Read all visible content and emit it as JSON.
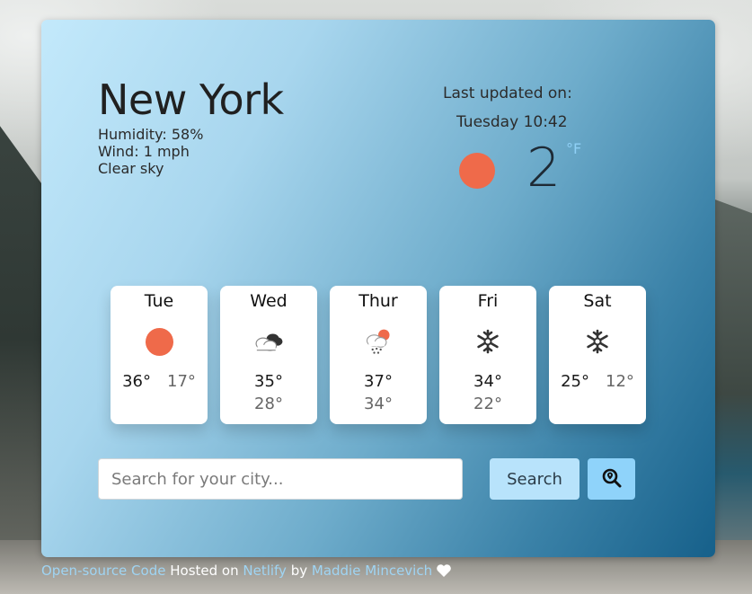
{
  "city": "New York",
  "current": {
    "humidity": "Humidity: 58%",
    "wind": "Wind: 1 mph",
    "description": "Clear sky",
    "updated_label": "Last updated on:",
    "updated_time": "Tuesday 10:42",
    "temperature": "2",
    "unit": "°F",
    "icon": "sun-icon"
  },
  "forecast": [
    {
      "day": "Tue",
      "icon": "sun-icon",
      "high": "36°",
      "low": "17°"
    },
    {
      "day": "Wed",
      "icon": "broken-clouds-icon",
      "high": "35°",
      "low": "28°"
    },
    {
      "day": "Thur",
      "icon": "rain-snow-sun-icon",
      "high": "37°",
      "low": "34°"
    },
    {
      "day": "Fri",
      "icon": "snowflake-icon",
      "high": "34°",
      "low": "22°"
    },
    {
      "day": "Sat",
      "icon": "snowflake-icon",
      "high": "25°",
      "low": "12°"
    }
  ],
  "search": {
    "placeholder": "Search for your city...",
    "button_label": "Search",
    "location_icon": "search-location-icon"
  },
  "footer": {
    "code_link": "Open-source Code",
    "hosted_text": " Hosted on ",
    "host_link": "Netlify",
    "by_text": " by ",
    "author_link": "Maddie Mincevich",
    "heart_icon": "heart-icon"
  },
  "colors": {
    "sun": "#ef6a4a",
    "unit": "#8fd0f6",
    "search_button": "#b8e3fb",
    "location_button": "#8fd3fa",
    "link": "#9fd4f3"
  }
}
